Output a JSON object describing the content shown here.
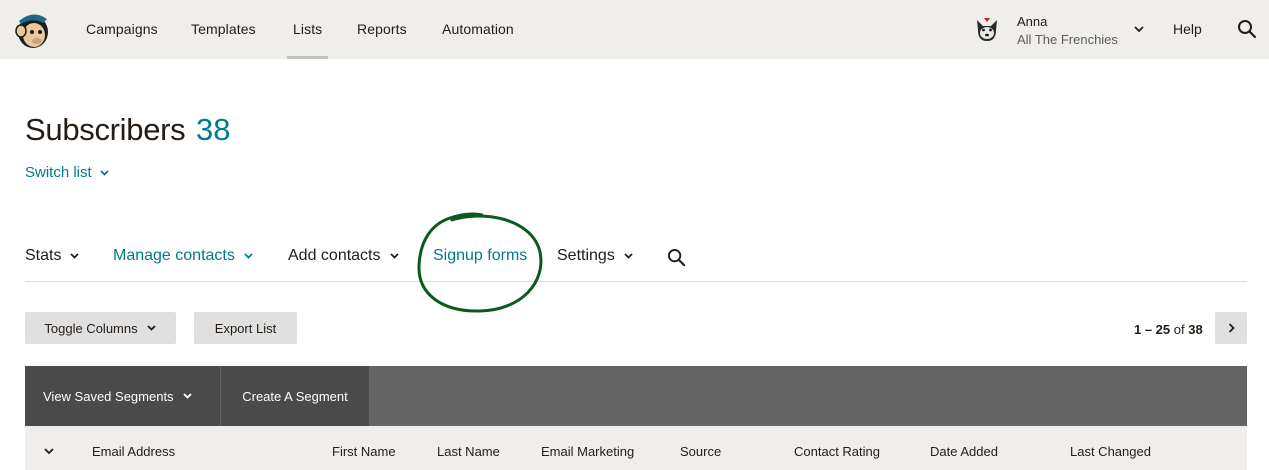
{
  "topnav": {
    "items": [
      {
        "label": "Campaigns"
      },
      {
        "label": "Templates"
      },
      {
        "label": "Lists",
        "active": true
      },
      {
        "label": "Reports"
      },
      {
        "label": "Automation"
      }
    ],
    "account": {
      "name": "Anna",
      "org": "All The Frenchies"
    },
    "help_label": "Help",
    "icons": {
      "logo": "mailchimp-freddie-logo",
      "avatar": "french-bulldog-avatar",
      "search": "search-icon"
    }
  },
  "header": {
    "title": "Subscribers",
    "count": "38",
    "switch_list_label": "Switch list"
  },
  "subnav": {
    "items": [
      {
        "label": "Stats",
        "has_dropdown": true
      },
      {
        "label": "Manage contacts",
        "has_dropdown": true,
        "highlight": true
      },
      {
        "label": "Add contacts",
        "has_dropdown": true
      },
      {
        "label": "Signup forms",
        "has_dropdown": false,
        "highlight": true,
        "annotated": "circled-green"
      },
      {
        "label": "Settings",
        "has_dropdown": true
      }
    ]
  },
  "toolbar": {
    "toggle_columns_label": "Toggle Columns",
    "export_list_label": "Export List",
    "pagination": {
      "range": "1 – 25",
      "of_label": "of",
      "total": "38"
    }
  },
  "segments": {
    "view_saved_label": "View Saved Segments",
    "create_label": "Create A Segment"
  },
  "table": {
    "columns": [
      "Email Address",
      "First Name",
      "Last Name",
      "Email Marketing",
      "Source",
      "Contact Rating",
      "Date Added",
      "Last Changed"
    ]
  },
  "colors": {
    "teal": "#007c89",
    "nav_bg": "#efeeea",
    "annotation": "#0b5a1e",
    "segbar": "#656565",
    "segbtn": "#4a4a4a"
  }
}
